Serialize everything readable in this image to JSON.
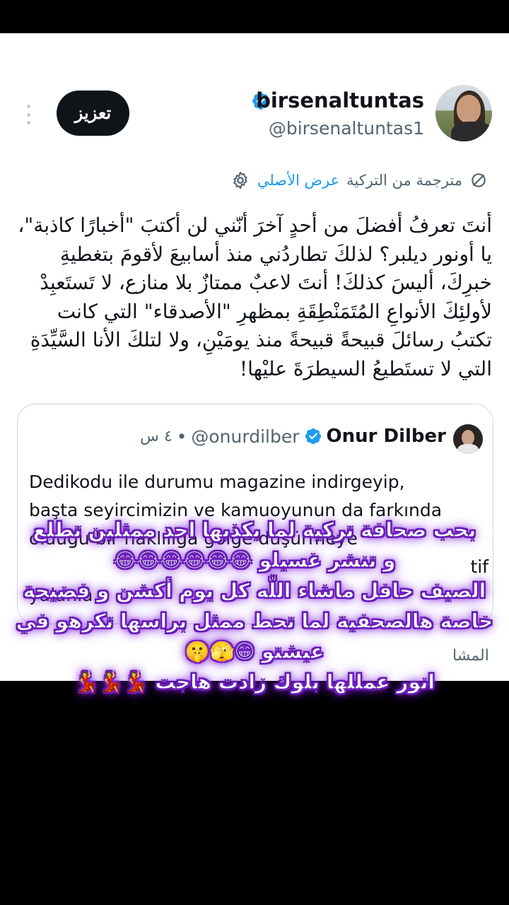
{
  "tweet": {
    "author_name": "birsenaltuntas",
    "author_handle": "@birsenaltuntas1",
    "follow_label": "تعزيز",
    "translated_from": "مترجمة من التركية",
    "show_original": "عرض الأصلي",
    "text": "أنتَ تعرفُ أفضلَ من أحدٍ آخرَ أنّني لن أكتبَ \"أخبارًا كاذبة\"، يا أونور ديلبر؟ لذلكَ تطاردُني منذ أسابيعَ لأقومَ بتغطيةِ خبرِكَ، أليسَ كذلكَ! أنتَ لاعبٌ ممتازٌ بلا منازع، لا تَستَعبِدْ لأولئِكَ الأنواعِ المُتَمَنْطِقَةِ بمظهرِ \"الأصدقاء\" التي كانت تكتبُ رسائلَ قبيحةً قبيحةً منذ يومَيْنِ، ولا لتلكَ الأنا السَّيِّدَةِ التي لا تستَطيعُ السيطرَةَ عليْها!",
    "views_label": "المشا"
  },
  "quoted_tweet": {
    "author_name": "Onur Dilber",
    "author_handle": "@onurdilber",
    "time": "٤ س",
    "text_lines": [
      "Dedikodu ile durumu magazine indirgeyip,",
      "başta seyircimizin ve kamuoyunun da farkında",
      "olduğu bir haklılığa gölge düşürmeye",
      "tif",
      "yalanla"
    ]
  },
  "caption_lines": [
    "بحب صحافة تركية لما يكذبها احد ممثلين تطلع",
    "و تنشر غسيلو 😂😂😂😂😂😂",
    "الصيف حافل ماشاء اللّٰه كل يوم أكشن و فضيحة",
    "خاصة هالصحفية لما تحط ممثل براسها تكرهو في",
    "عيشتو 😁🫣🤫",
    "انور عمللها بلوك زادت هاجت 💃💃💃"
  ],
  "colors": {
    "accent_blue": "#1d9bf0",
    "text": "#0f1419",
    "muted": "#536471",
    "caption_glow": "#8a2be2"
  },
  "icons": [
    "more-vertical-icon",
    "verified-badge-icon",
    "translate-icon",
    "gear-icon"
  ]
}
